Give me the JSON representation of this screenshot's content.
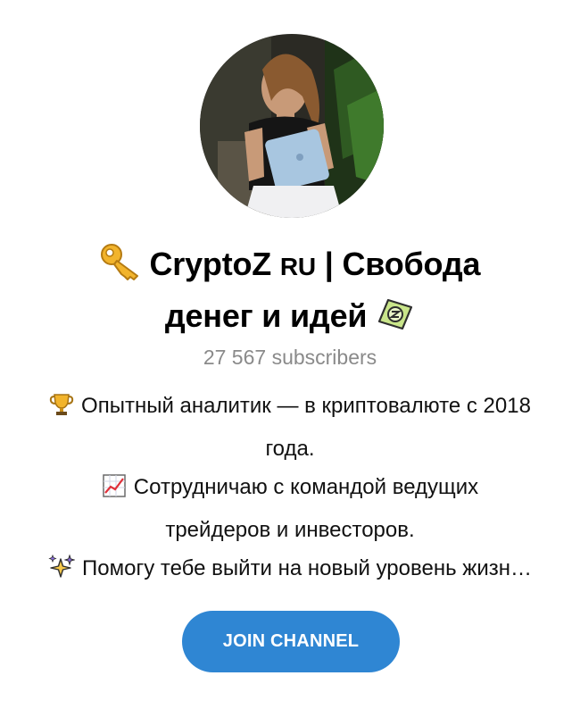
{
  "channel": {
    "title_line1": "CryptoZ",
    "title_ru": "RU",
    "title_rest": "| Свобода",
    "title_line2": "денег и идей",
    "subscribers": "27 567 subscribers",
    "description": [
      {
        "icon": "trophy-icon",
        "text": "Опытный аналитик — в криптовалюте с 2018"
      },
      {
        "icon": "",
        "text": "года."
      },
      {
        "icon": "chart-increasing-icon",
        "text": "Сотрудничаю с командой ведущих"
      },
      {
        "icon": "",
        "text": "трейдеров и инвесторов."
      },
      {
        "icon": "sparkles-icon",
        "text": "Помогу тебе выйти на новый уровень жизн…"
      }
    ]
  },
  "join_button": {
    "label": "JOIN CHANNEL"
  },
  "colors": {
    "accent": "#2f86d3",
    "subscribers_text": "#8a8a8a"
  },
  "icons": {
    "title_start": "key-icon",
    "title_end": "money-emblem-icon"
  }
}
